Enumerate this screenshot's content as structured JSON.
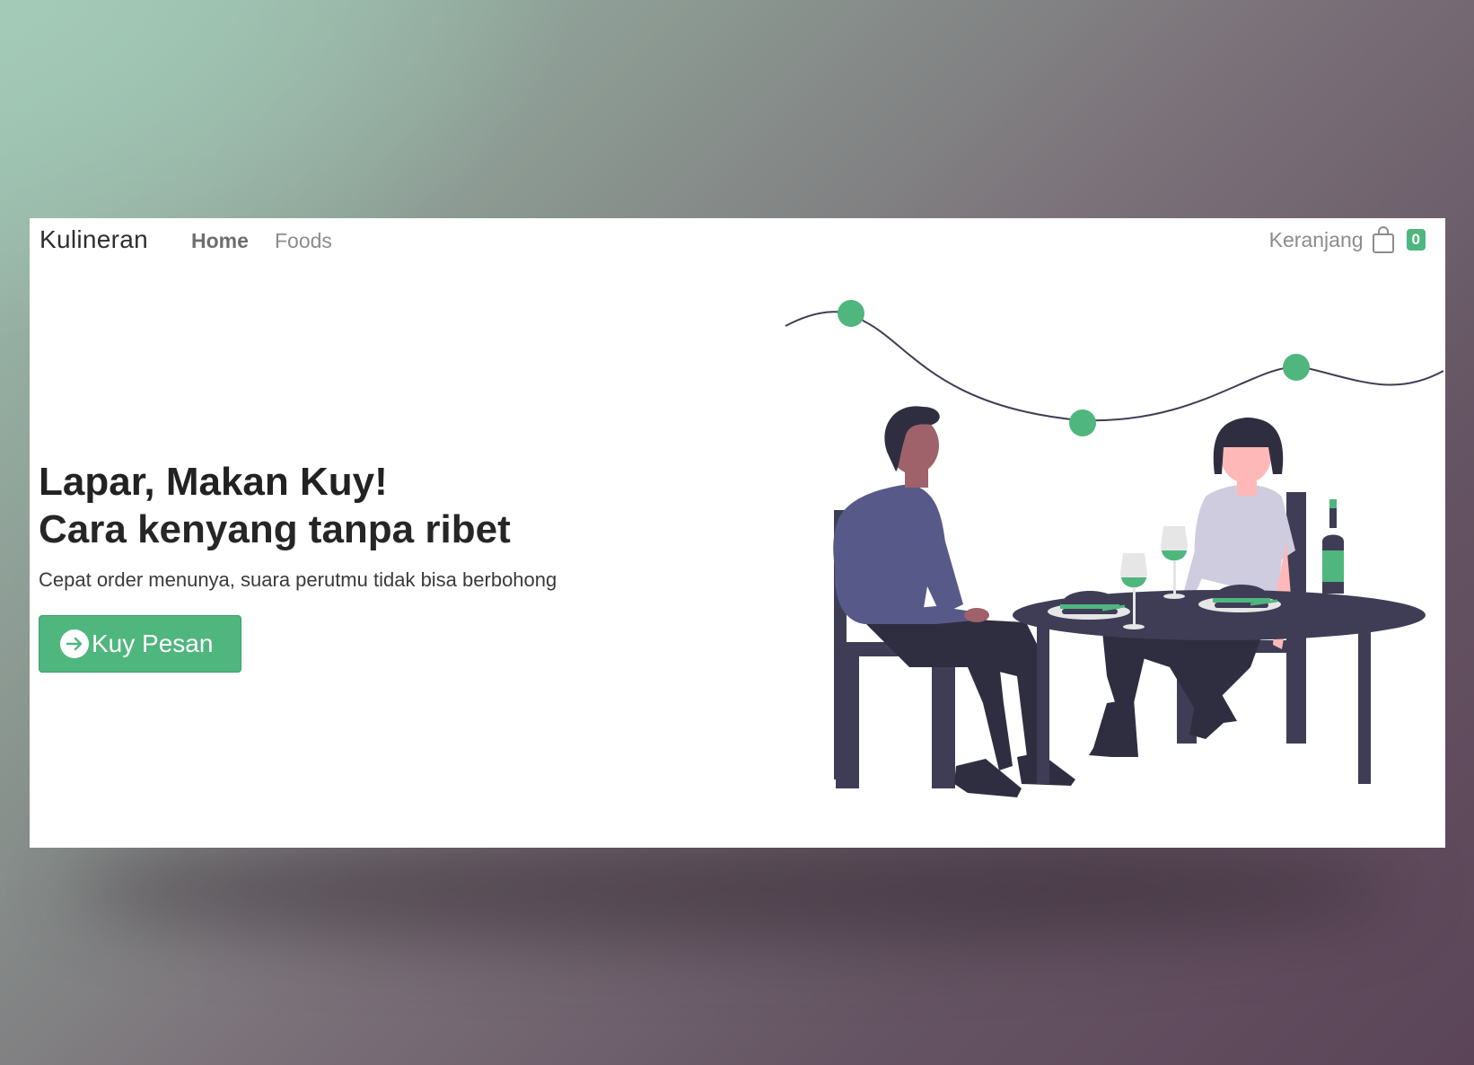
{
  "navbar": {
    "brand": "Kulineran",
    "links": [
      {
        "label": "Home",
        "active": true
      },
      {
        "label": "Foods",
        "active": false
      }
    ],
    "cart": {
      "label": "Keranjang",
      "icon": "shopping-bag-icon",
      "count": "0"
    }
  },
  "hero": {
    "title": "Lapar, Makan Kuy!",
    "subtitle": "Cara kenyang tanpa ribet",
    "description": "Cepat order menunya, suara perutmu tidak bisa berbohong",
    "cta": {
      "label": "Kuy Pesan",
      "icon": "arrow-right-circle-icon"
    },
    "illustration": "couple-dining-illustration"
  },
  "colors": {
    "accent": "#4fb67e",
    "text_dark": "#222222",
    "text_muted": "#8c8c8c",
    "illustration_dark": "#3f3d56"
  }
}
